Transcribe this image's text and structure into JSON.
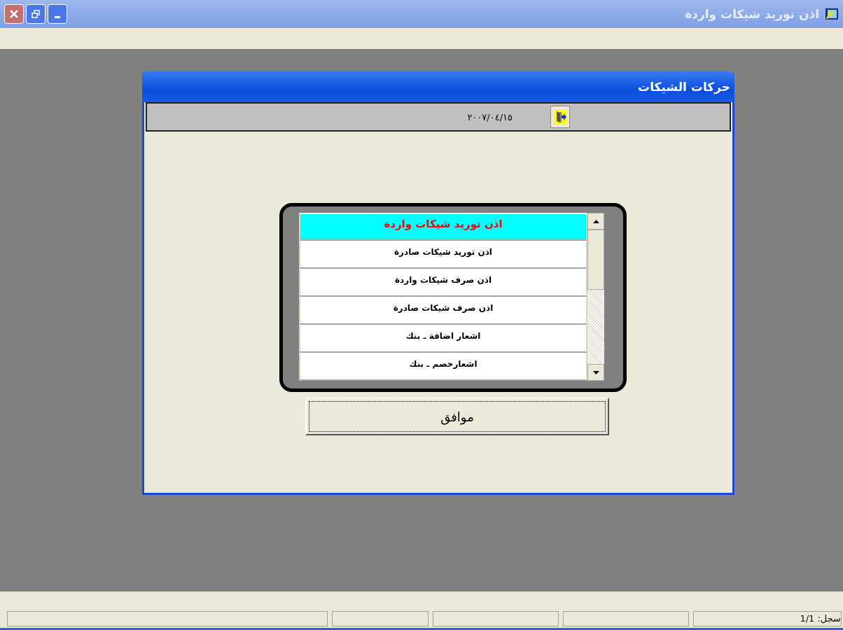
{
  "window": {
    "title": "اذن توريد شيكات واردة"
  },
  "form": {
    "title": "حركات الشيكات",
    "date": "٢٠٠٧/٠٤/١٥",
    "items": [
      {
        "label": "اذن توريد شيكات واردة",
        "selected": true
      },
      {
        "label": "اذن توريد شيكات صادرة",
        "selected": false
      },
      {
        "label": "اذن صرف شيكات واردة",
        "selected": false
      },
      {
        "label": "اذن صرف شيكات صادرة",
        "selected": false
      },
      {
        "label": "اشعار اضافة ـ بنك",
        "selected": false
      },
      {
        "label": "اشعارخصم  ـ بنك",
        "selected": false
      }
    ],
    "ok_button": "موافق"
  },
  "status_bar": {
    "record": "سجل: 1/1"
  }
}
